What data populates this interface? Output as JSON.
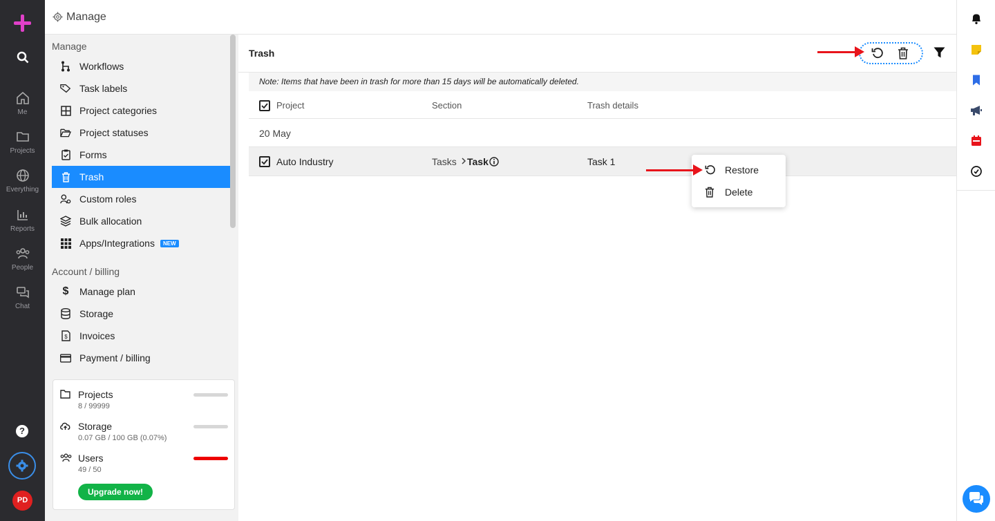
{
  "rail": {
    "items": [
      {
        "label": "Me",
        "icon": "home-icon"
      },
      {
        "label": "Projects",
        "icon": "folder-icon"
      },
      {
        "label": "Everything",
        "icon": "globe-icon"
      },
      {
        "label": "Reports",
        "icon": "chart-icon"
      },
      {
        "label": "People",
        "icon": "people-icon"
      },
      {
        "label": "Chat",
        "icon": "chat-icon"
      }
    ],
    "avatar": "PD",
    "help": "?"
  },
  "topbar": {
    "title": "Manage"
  },
  "sidenav": {
    "manage_heading": "Manage",
    "items": [
      {
        "label": "Workflows",
        "icon": "workflow-icon"
      },
      {
        "label": "Task labels",
        "icon": "tag-icon"
      },
      {
        "label": "Project categories",
        "icon": "grid-icon"
      },
      {
        "label": "Project statuses",
        "icon": "folder-open-icon"
      },
      {
        "label": "Forms",
        "icon": "clipboard-icon"
      },
      {
        "label": "Trash",
        "icon": "trash-icon"
      },
      {
        "label": "Custom roles",
        "icon": "user-role-icon"
      },
      {
        "label": "Bulk allocation",
        "icon": "layers-icon"
      },
      {
        "label": "Apps/Integrations",
        "icon": "apps-icon",
        "badge": "NEW"
      }
    ],
    "billing_heading": "Account / billing",
    "billing_items": [
      {
        "label": "Manage plan",
        "icon": "dollar-icon"
      },
      {
        "label": "Storage",
        "icon": "database-icon"
      },
      {
        "label": "Invoices",
        "icon": "invoice-icon"
      },
      {
        "label": "Payment / billing",
        "icon": "credit-card-icon"
      }
    ],
    "usage": [
      {
        "name": "Projects",
        "value": "8 / 99999",
        "icon": "folder-icon",
        "fraction": 0.0001
      },
      {
        "name": "Storage",
        "value": "0.07 GB / 100 GB (0.07%)",
        "icon": "cloud-upload-icon",
        "fraction": 0.0007
      },
      {
        "name": "Users",
        "value": "49 / 50",
        "icon": "people-icon",
        "fraction": 0.98
      }
    ],
    "upgrade_label": "Upgrade now!"
  },
  "main": {
    "title": "Trash",
    "note": "Note: Items that have been in trash for more than 15 days will be automatically deleted.",
    "columns": [
      "Project",
      "Section",
      "Trash details"
    ],
    "group_date": "20 May",
    "rows": [
      {
        "project": "Auto Industry",
        "section_parent": "Tasks",
        "section_child": "Task",
        "details": "Task 1",
        "checked": true
      }
    ],
    "context_menu": [
      "Restore",
      "Delete"
    ]
  },
  "colors": {
    "accent": "#1a8cff",
    "brand_plus": "#e040c8",
    "danger": "#e8141b",
    "success": "#12b347"
  }
}
